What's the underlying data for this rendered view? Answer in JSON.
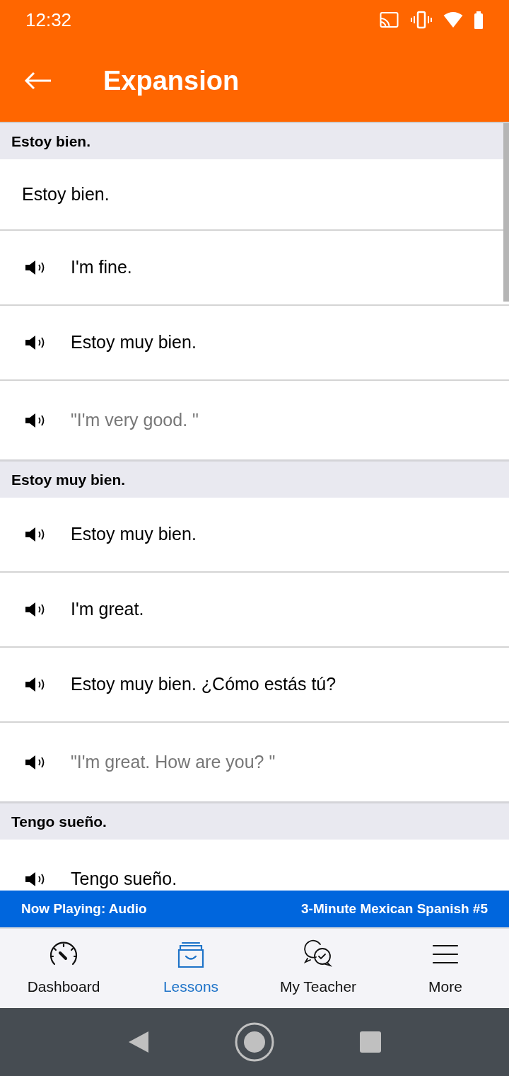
{
  "status_bar": {
    "time": "12:32"
  },
  "app_bar": {
    "title": "Expansion"
  },
  "sections": [
    {
      "heading": "Estoy bien.",
      "rows": [
        {
          "kind": "plain",
          "text": "Estoy bien."
        },
        {
          "kind": "audio",
          "text": "I'm fine."
        },
        {
          "kind": "audio",
          "text": "Estoy muy bien."
        },
        {
          "kind": "translation",
          "text": "\"I'm very good. \""
        }
      ]
    },
    {
      "heading": "Estoy muy bien.",
      "rows": [
        {
          "kind": "audio",
          "text": "Estoy muy bien."
        },
        {
          "kind": "audio",
          "text": "I'm great."
        },
        {
          "kind": "audio",
          "text": "Estoy muy bien. ¿Cómo estás tú?"
        },
        {
          "kind": "translation",
          "text": "\"I'm great. How are you? \""
        }
      ]
    },
    {
      "heading": "Tengo sueño.",
      "rows": [
        {
          "kind": "audio",
          "text": "Tengo sueño."
        }
      ]
    }
  ],
  "now_playing": {
    "label": "Now Playing: Audio",
    "lesson": "3-Minute Mexican Spanish #5"
  },
  "tabs": [
    {
      "label": "Dashboard",
      "kind": "gauge",
      "selected": false
    },
    {
      "label": "Lessons",
      "kind": "box",
      "selected": true
    },
    {
      "label": "My Teacher",
      "kind": "chat",
      "selected": false
    },
    {
      "label": "More",
      "kind": "menu",
      "selected": false
    }
  ]
}
